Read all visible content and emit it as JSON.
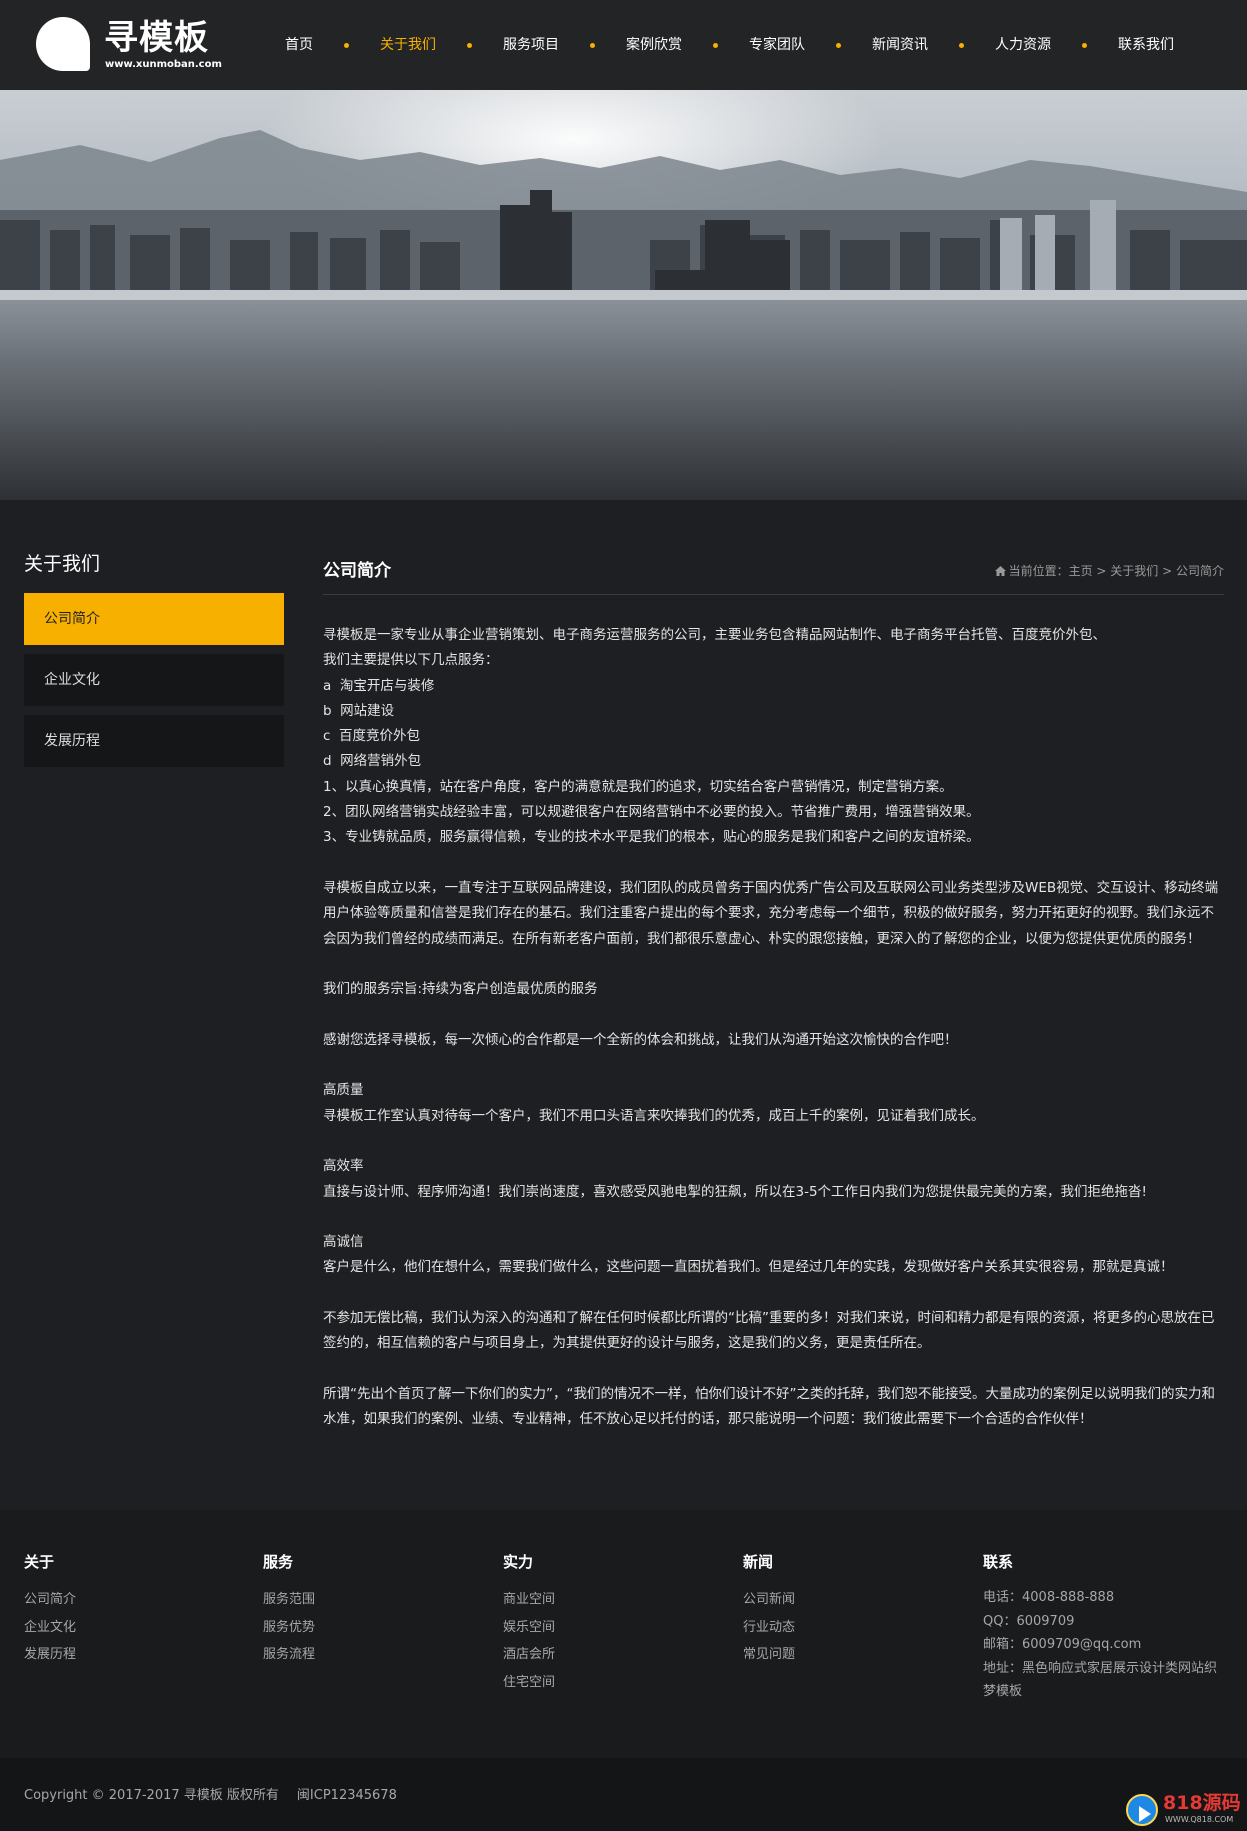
{
  "header": {
    "logo_name": "寻模板",
    "logo_url": "www.xunmoban.com",
    "nav": [
      {
        "label": "首页",
        "active": false
      },
      {
        "label": "关于我们",
        "active": true
      },
      {
        "label": "服务项目",
        "active": false
      },
      {
        "label": "案例欣赏",
        "active": false
      },
      {
        "label": "专家团队",
        "active": false
      },
      {
        "label": "新闻资讯",
        "active": false
      },
      {
        "label": "人力资源",
        "active": false
      },
      {
        "label": "联系我们",
        "active": false
      }
    ]
  },
  "sidebar": {
    "title": "关于我们",
    "items": [
      {
        "label": "公司简介",
        "active": true
      },
      {
        "label": "企业文化",
        "active": false
      },
      {
        "label": "发展历程",
        "active": false
      }
    ]
  },
  "main": {
    "title": "公司简介",
    "breadcrumb": {
      "prefix": "当前位置：",
      "items": [
        "主页",
        "关于我们",
        "公司简介"
      ],
      "separator": " > "
    },
    "paragraphs": [
      "寻模板是一家专业从事企业营销策划、电子商务运营服务的公司，主要业务包含精品网站制作、电子商务平台托管、百度竞价外包、",
      "我们主要提供以下几点服务：",
      "a  淘宝开店与装修",
      "b  网站建设",
      "c  百度竞价外包",
      "d  网络营销外包",
      "1、以真心换真情，站在客户角度，客户的满意就是我们的追求，切实结合客户营销情况，制定营销方案。",
      "2、团队网络营销实战经验丰富，可以规避很客户在网络营销中不必要的投入。节省推广费用，增强营销效果。",
      "3、专业铸就品质，服务赢得信赖，专业的技术水平是我们的根本，贴心的服务是我们和客户之间的友谊桥梁。",
      "",
      "寻模板自成立以来，一直专注于互联网品牌建设，我们团队的成员曾务于国内优秀广告公司及互联网公司业务类型涉及WEB视觉、交互设计、移动终端用户体验等质量和信誉是我们存在的基石。我们注重客户提出的每个要求，充分考虑每一个细节，积极的做好服务，努力开拓更好的视野。我们永远不会因为我们曾经的成绩而满足。在所有新老客户面前，我们都很乐意虚心、朴实的跟您接触，更深入的了解您的企业，以便为您提供更优质的服务！",
      "",
      "我们的服务宗旨:持续为客户创造最优质的服务",
      "",
      "感谢您选择寻模板，每一次倾心的合作都是一个全新的体会和挑战，让我们从沟通开始这次愉快的合作吧！",
      "",
      "高质量",
      "寻模板工作室认真对待每一个客户，我们不用口头语言来吹捧我们的优秀，成百上千的案例，见证着我们成长。",
      "",
      "高效率",
      "直接与设计师、程序师沟通！我们崇尚速度，喜欢感受风驰电掣的狂飙，所以在3-5个工作日内我们为您提供最完美的方案，我们拒绝拖沓!",
      "",
      "高诚信",
      "客户是什么，他们在想什么，需要我们做什么，这些问题一直困扰着我们。但是经过几年的实践，发现做好客户关系其实很容易，那就是真诚！",
      "",
      "不参加无偿比稿，我们认为深入的沟通和了解在任何时候都比所谓的“比稿”重要的多！对我们来说，时间和精力都是有限的资源，将更多的心思放在已签约的，相互信赖的客户与项目身上，为其提供更好的设计与服务，这是我们的义务，更是责任所在。",
      "",
      "所谓“先出个首页了解一下你们的实力”，“我们的情况不一样，怕你们设计不好”之类的托辞，我们恕不能接受。大量成功的案例足以说明我们的实力和水准，如果我们的案例、业绩、专业精神，任不放心足以托付的话，那只能说明一个问题：我们彼此需要下一个合适的合作伙伴！"
    ]
  },
  "footer": {
    "columns": [
      {
        "title": "关于",
        "links": [
          "公司简介",
          "企业文化",
          "发展历程"
        ]
      },
      {
        "title": "服务",
        "links": [
          "服务范围",
          "服务优势",
          "服务流程"
        ]
      },
      {
        "title": "实力",
        "links": [
          "商业空间",
          "娱乐空间",
          "酒店会所",
          "住宅空间"
        ]
      },
      {
        "title": "新闻",
        "links": [
          "公司新闻",
          "行业动态",
          "常见问题"
        ]
      }
    ],
    "contact": {
      "title": "联系",
      "phone": "电话：4008-888-888",
      "qq": "QQ：6009709",
      "email": "邮箱：6009709@qq.com",
      "address": "地址：黑色响应式家居展示设计类网站织梦模板"
    },
    "copyright": "Copyright © 2017-2017 寻模板 版权所有",
    "icp": "闽ICP12345678",
    "badge_text": "818源码",
    "badge_sub": "WWW.Q818.COM"
  },
  "colors": {
    "accent": "#f7b000",
    "background": "#1e1f22",
    "header": "#232426",
    "sidebar_item": "#151618"
  }
}
